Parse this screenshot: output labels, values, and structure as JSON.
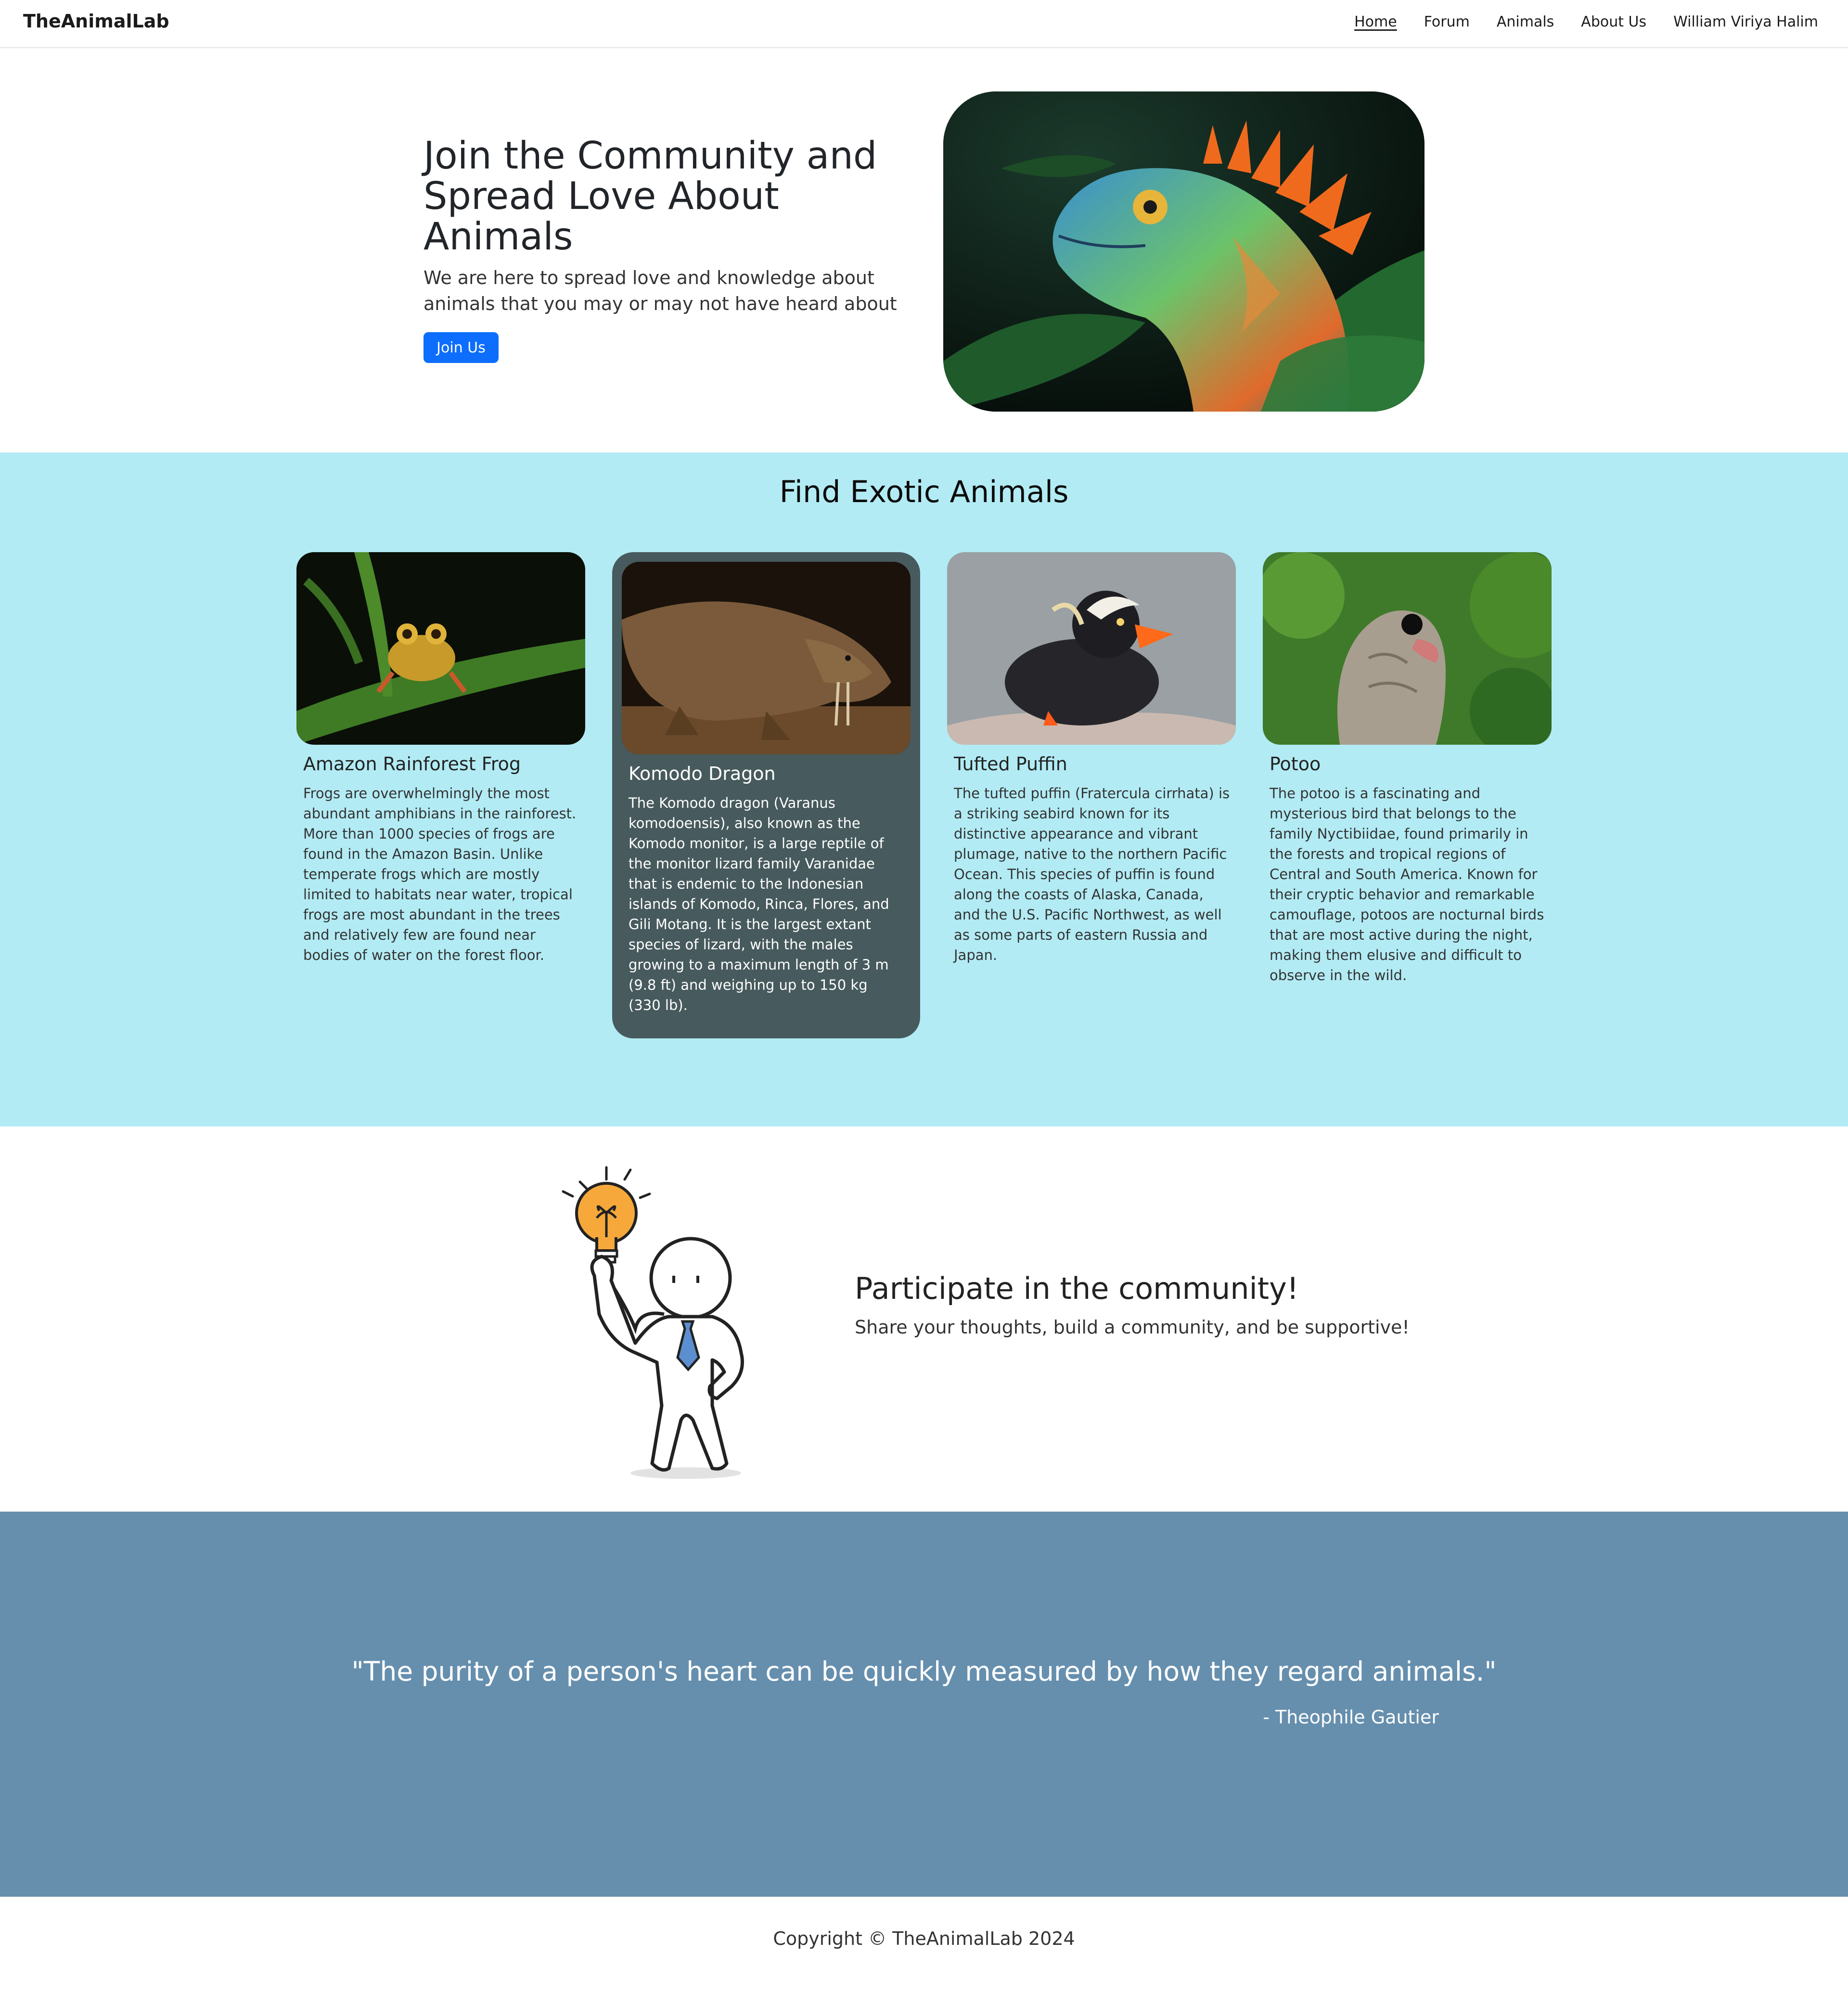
{
  "navbar": {
    "brand": "TheAnimalLab",
    "links": [
      "Home",
      "Forum",
      "Animals",
      "About Us",
      "William Viriya Halim"
    ],
    "active_link": "Home"
  },
  "hero": {
    "title": "Join the Community and Spread Love About Animals",
    "subtitle": "We are here to spread love and knowledge about animals that you may or may not have heard about",
    "button_label": "Join Us"
  },
  "exotic": {
    "title": "Find Exotic Animals",
    "cards": [
      {
        "title": "Amazon Rainforest Frog",
        "text": "Frogs are overwhelmingly the most abundant amphibians in the rainforest. More than 1000 species of frogs are found in the Amazon Basin. Unlike temperate frogs which are mostly limited to habitats near water, tropical frogs are most abundant in the trees and relatively few are found near bodies of water on the forest floor."
      },
      {
        "title": "Komodo Dragon",
        "text": "The Komodo dragon (Varanus komodoensis), also known as the Komodo monitor, is a large reptile of the monitor lizard family Varanidae that is endemic to the Indonesian islands of Komodo, Rinca, Flores, and Gili Motang. It is the largest extant species of lizard, with the males growing to a maximum length of 3 m (9.8 ft) and weighing up to 150 kg (330 lb)."
      },
      {
        "title": "Tufted Puffin",
        "text": "The tufted puffin (Fratercula cirrhata) is a striking seabird known for its distinctive appearance and vibrant plumage, native to the northern Pacific Ocean. This species of puffin is found along the coasts of Alaska, Canada, and the U.S. Pacific Northwest, as well as some parts of eastern Russia and Japan."
      },
      {
        "title": "Potoo",
        "text": "The potoo is a fascinating and mysterious bird that belongs to the family Nyctibiidae, found primarily in the forests and tropical regions of Central and South America. Known for their cryptic behavior and remarkable camouflage, potoos are nocturnal birds that are most active during the night, making them elusive and difficult to observe in the wild."
      }
    ]
  },
  "community": {
    "title": "Participate in the community!",
    "subtitle": "Share your thoughts, build a community, and be supportive!"
  },
  "quote": {
    "text": "\"The purity of a person's heart can be quickly measured by how they regard animals.\"",
    "author": "- Theophile Gautier"
  },
  "footer": {
    "text": "Copyright © TheAnimalLab 2024"
  },
  "colors": {
    "primary": "#0d6efd",
    "exotic_bg": "#b2ebf4",
    "highlight_card": "#475a5d",
    "quote_bg": "#668fae"
  }
}
